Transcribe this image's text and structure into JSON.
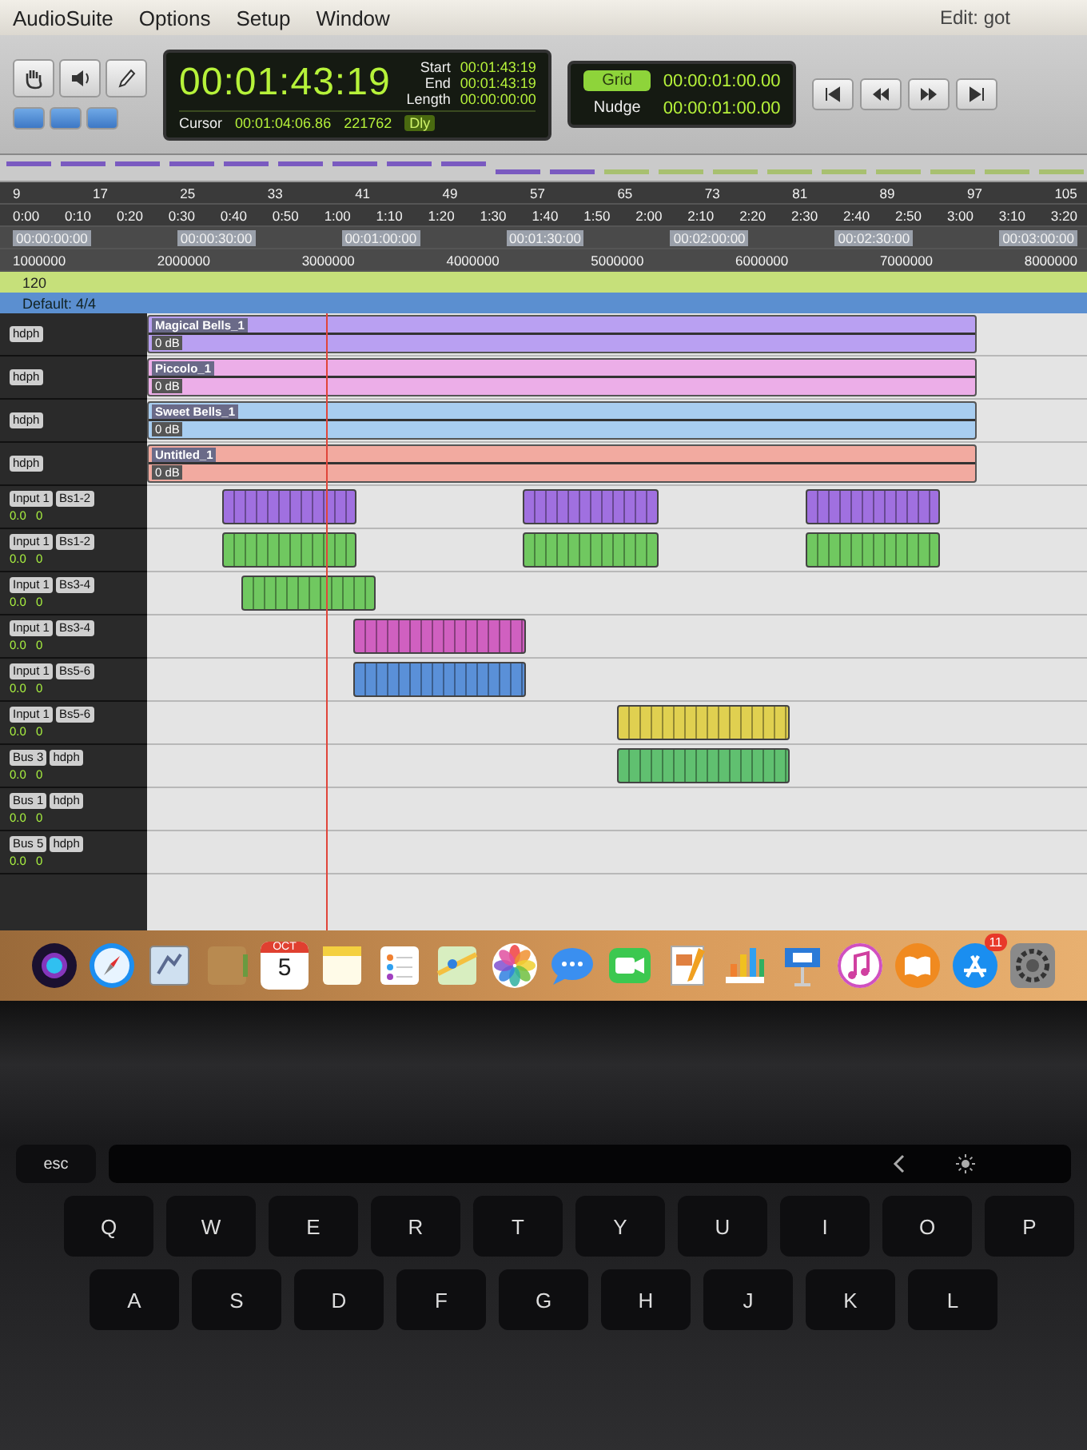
{
  "menu_bar": {
    "items": [
      "AudioSuite",
      "Options",
      "Setup",
      "Window"
    ],
    "window_title": "Edit: got"
  },
  "counter": {
    "main": "00:01:43:19",
    "start_label": "Start",
    "start": "00:01:43:19",
    "end_label": "End",
    "end": "00:01:43:19",
    "length_label": "Length",
    "length": "00:00:00:00",
    "cursor_label": "Cursor",
    "cursor": "00:01:04:06.86",
    "samples": "221762",
    "delay": "Dly"
  },
  "edit_modes": [
    {
      "label": "Grid",
      "value": "00:00:01:00.00",
      "selected": true
    },
    {
      "label": "Nudge",
      "value": "00:00:01:00.00",
      "selected": false
    }
  ],
  "rulers": [
    {
      "kind": "bars",
      "marks": [
        "9",
        "17",
        "25",
        "33",
        "41",
        "49",
        "57",
        "65",
        "73",
        "81",
        "89",
        "97",
        "105"
      ]
    },
    {
      "kind": "minsecs",
      "marks": [
        "0:00",
        "0:10",
        "0:20",
        "0:30",
        "0:40",
        "0:50",
        "1:00",
        "1:10",
        "1:20",
        "1:30",
        "1:40",
        "1:50",
        "2:00",
        "2:10",
        "2:20",
        "2:30",
        "2:40",
        "2:50",
        "3:00",
        "3:10",
        "3:20"
      ]
    },
    {
      "kind": "timecode",
      "marks": [
        "00:00:00:00",
        "00:00:30:00",
        "00:01:00:00",
        "00:01:30:00",
        "00:02:00:00",
        "00:02:30:00",
        "00:03:00:00"
      ]
    },
    {
      "kind": "samples",
      "marks": [
        "1000000",
        "2000000",
        "3000000",
        "4000000",
        "5000000",
        "6000000",
        "7000000",
        "8000000"
      ]
    }
  ],
  "tempo": "120",
  "meter": "Default: 4/4",
  "tracks": [
    {
      "name": "Magical Bells_1",
      "gain": "0 dB",
      "color": "#b9a0f2"
    },
    {
      "name": "Piccolo_1",
      "gain": "0 dB",
      "color": "#ecaee8"
    },
    {
      "name": "Sweet Bells_1",
      "gain": "0 dB",
      "color": "#a8cdf0"
    },
    {
      "name": "Untitled_1",
      "gain": "0 dB",
      "color": "#f2aaa0"
    }
  ],
  "mixer_rows": [
    {
      "output": "hdph"
    },
    {
      "output": "hdph"
    },
    {
      "output": "hdph"
    },
    {
      "output": "hdph"
    },
    {
      "input": "Input 1",
      "output": "Bs1-2",
      "volume": "0.0",
      "pan": "0"
    },
    {
      "input": "Input 1",
      "output": "Bs1-2",
      "volume": "0.0",
      "pan": "0"
    },
    {
      "input": "Input 1",
      "output": "Bs3-4",
      "volume": "0.0",
      "pan": "0"
    },
    {
      "input": "Input 1",
      "output": "Bs3-4",
      "volume": "0.0",
      "pan": "0"
    },
    {
      "input": "Input 1",
      "output": "Bs5-6",
      "volume": "0.0",
      "pan": "0"
    },
    {
      "input": "Input 1",
      "output": "Bs5-6",
      "volume": "0.0",
      "pan": "0"
    },
    {
      "input": "Bus 3",
      "output": "hdph",
      "volume": "0.0",
      "pan": "0"
    },
    {
      "input": "Bus 1",
      "output": "hdph",
      "volume": "0.0",
      "pan": "0"
    },
    {
      "input": "Bus 5",
      "output": "hdph",
      "volume": "0.0",
      "pan": "0"
    }
  ],
  "dock": {
    "calendar_month": "OCT",
    "calendar_day": "5",
    "badge": "11"
  },
  "keyboard": {
    "rows": [
      [
        "esc"
      ],
      [
        "Q",
        "W",
        "E",
        "R",
        "T",
        "Y",
        "U",
        "I",
        "O",
        "P"
      ],
      [
        "A",
        "S",
        "D",
        "F",
        "G",
        "H",
        "J",
        "K",
        "L"
      ]
    ]
  }
}
